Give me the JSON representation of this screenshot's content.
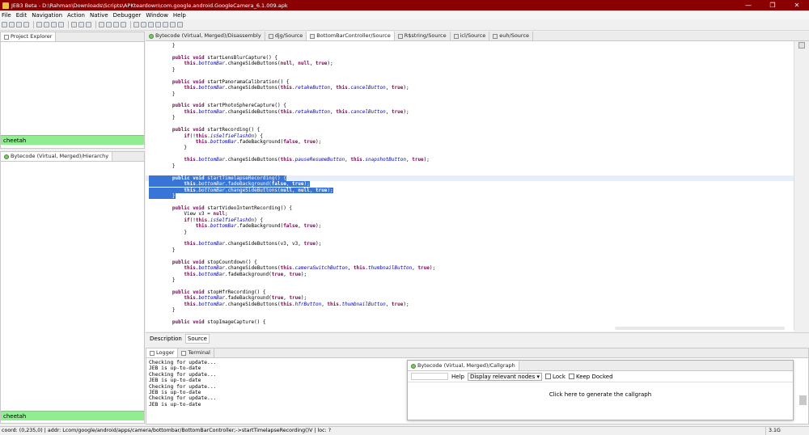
{
  "window": {
    "title": "JEB3 Beta - D:\\Rahman\\Downloads\\Scripts\\APKteardown\\com.google.android.GoogleCamera_6.1.009.apk",
    "min": "—",
    "max": "❐",
    "close": "✕"
  },
  "menu": [
    "File",
    "Edit",
    "Navigation",
    "Action",
    "Native",
    "Debugger",
    "Window",
    "Help"
  ],
  "project_explorer": {
    "tab": "Project Explorer",
    "selected": "cheetah"
  },
  "hierarchy": {
    "tab": "Bytecode (Virtual, Merged)/Hierarchy",
    "selected": "cheetah"
  },
  "editor_tabs": [
    "Bytecode (Virtual, Merged)/Disassembly",
    "djg/Source",
    "BottomBarController/Source",
    "R$string/Source",
    "icl/Source",
    "euh/Source"
  ],
  "bottom_tabs": [
    "Description",
    "Source"
  ],
  "code": [
    [
      [
        "        }",
        ""
      ]
    ],
    [
      [
        "",
        ""
      ]
    ],
    [
      [
        "        ",
        ""
      ],
      [
        "public void",
        "kw"
      ],
      [
        " startLensBlurCapture() {",
        ""
      ]
    ],
    [
      [
        "            ",
        ""
      ],
      [
        "this",
        "kw"
      ],
      [
        ".",
        ""
      ],
      [
        "bottomBar",
        "fld"
      ],
      [
        ".changeSideButtons(",
        ""
      ],
      [
        "null",
        "kw"
      ],
      [
        ", ",
        ""
      ],
      [
        "null",
        "kw"
      ],
      [
        ", ",
        ""
      ],
      [
        "true",
        "kw"
      ],
      [
        ");",
        ""
      ]
    ],
    [
      [
        "        }",
        ""
      ]
    ],
    [
      [
        "",
        ""
      ]
    ],
    [
      [
        "        ",
        ""
      ],
      [
        "public void",
        "kw"
      ],
      [
        " startPanoramaCalibration() {",
        ""
      ]
    ],
    [
      [
        "            ",
        ""
      ],
      [
        "this",
        "kw"
      ],
      [
        ".",
        ""
      ],
      [
        "bottomBar",
        "fld"
      ],
      [
        ".changeSideButtons(",
        ""
      ],
      [
        "this",
        "kw"
      ],
      [
        ".",
        ""
      ],
      [
        "retakeButton",
        "fld"
      ],
      [
        ", ",
        ""
      ],
      [
        "this",
        "kw"
      ],
      [
        ".",
        ""
      ],
      [
        "cancelButton",
        "fld"
      ],
      [
        ", ",
        ""
      ],
      [
        "true",
        "kw"
      ],
      [
        ");",
        ""
      ]
    ],
    [
      [
        "        }",
        ""
      ]
    ],
    [
      [
        "",
        ""
      ]
    ],
    [
      [
        "        ",
        ""
      ],
      [
        "public void",
        "kw"
      ],
      [
        " startPhotoSphereCapture() {",
        ""
      ]
    ],
    [
      [
        "            ",
        ""
      ],
      [
        "this",
        "kw"
      ],
      [
        ".",
        ""
      ],
      [
        "bottomBar",
        "fld"
      ],
      [
        ".changeSideButtons(",
        ""
      ],
      [
        "this",
        "kw"
      ],
      [
        ".",
        ""
      ],
      [
        "retakeButton",
        "fld"
      ],
      [
        ", ",
        ""
      ],
      [
        "this",
        "kw"
      ],
      [
        ".",
        ""
      ],
      [
        "cancelButton",
        "fld"
      ],
      [
        ", ",
        ""
      ],
      [
        "true",
        "kw"
      ],
      [
        ");",
        ""
      ]
    ],
    [
      [
        "        }",
        ""
      ]
    ],
    [
      [
        "",
        ""
      ]
    ],
    [
      [
        "        ",
        ""
      ],
      [
        "public void",
        "kw"
      ],
      [
        " startRecording() {",
        ""
      ]
    ],
    [
      [
        "            ",
        ""
      ],
      [
        "if",
        "kw"
      ],
      [
        "(!",
        ""
      ],
      [
        "this",
        "kw"
      ],
      [
        ".",
        ""
      ],
      [
        "isSelfieFlashOn",
        "fld"
      ],
      [
        ") {",
        ""
      ]
    ],
    [
      [
        "                ",
        ""
      ],
      [
        "this",
        "kw"
      ],
      [
        ".",
        ""
      ],
      [
        "bottomBar",
        "fld"
      ],
      [
        ".fadeBackground(",
        ""
      ],
      [
        "false",
        "kw"
      ],
      [
        ", ",
        ""
      ],
      [
        "true",
        "kw"
      ],
      [
        ");",
        ""
      ]
    ],
    [
      [
        "            }",
        ""
      ]
    ],
    [
      [
        "",
        ""
      ]
    ],
    [
      [
        "            ",
        ""
      ],
      [
        "this",
        "kw"
      ],
      [
        ".",
        ""
      ],
      [
        "bottomBar",
        "fld"
      ],
      [
        ".changeSideButtons(",
        ""
      ],
      [
        "this",
        "kw"
      ],
      [
        ".",
        ""
      ],
      [
        "pauseResumeButton",
        "fld"
      ],
      [
        ", ",
        ""
      ],
      [
        "this",
        "kw"
      ],
      [
        ".",
        ""
      ],
      [
        "snapshotButton",
        "fld"
      ],
      [
        ", ",
        ""
      ],
      [
        "true",
        "kw"
      ],
      [
        ");",
        ""
      ]
    ],
    [
      [
        "        }",
        ""
      ]
    ],
    [
      [
        "",
        ""
      ]
    ],
    [
      [
        "        ",
        ""
      ],
      [
        "public void",
        "kw"
      ],
      [
        " startTimelapseRecording() {",
        ""
      ]
    ],
    [
      [
        "            ",
        ""
      ],
      [
        "this",
        "kw"
      ],
      [
        ".",
        ""
      ],
      [
        "bottomBar",
        "fld"
      ],
      [
        ".fadeBackground(",
        ""
      ],
      [
        "false",
        "kw"
      ],
      [
        ", ",
        ""
      ],
      [
        "true",
        "kw"
      ],
      [
        ");",
        ""
      ]
    ],
    [
      [
        "            ",
        ""
      ],
      [
        "this",
        "kw"
      ],
      [
        ".",
        ""
      ],
      [
        "bottomBar",
        "fld"
      ],
      [
        ".changeSideButtons(",
        ""
      ],
      [
        "null",
        "kw"
      ],
      [
        ", ",
        ""
      ],
      [
        "null",
        "kw"
      ],
      [
        ", ",
        ""
      ],
      [
        "true",
        "kw"
      ],
      [
        ");",
        ""
      ]
    ],
    [
      [
        "        }",
        ""
      ]
    ],
    [
      [
        "",
        ""
      ]
    ],
    [
      [
        "        ",
        ""
      ],
      [
        "public void",
        "kw"
      ],
      [
        " startVideoIntentRecording() {",
        ""
      ]
    ],
    [
      [
        "            View v3 = ",
        ""
      ],
      [
        "null",
        "kw"
      ],
      [
        ";",
        ""
      ]
    ],
    [
      [
        "            ",
        ""
      ],
      [
        "if",
        "kw"
      ],
      [
        "(!",
        ""
      ],
      [
        "this",
        "kw"
      ],
      [
        ".",
        ""
      ],
      [
        "isSelfieFlashOn",
        "fld"
      ],
      [
        ") {",
        ""
      ]
    ],
    [
      [
        "                ",
        ""
      ],
      [
        "this",
        "kw"
      ],
      [
        ".",
        ""
      ],
      [
        "bottomBar",
        "fld"
      ],
      [
        ".fadeBackground(",
        ""
      ],
      [
        "false",
        "kw"
      ],
      [
        ", ",
        ""
      ],
      [
        "true",
        "kw"
      ],
      [
        ");",
        ""
      ]
    ],
    [
      [
        "            }",
        ""
      ]
    ],
    [
      [
        "",
        ""
      ]
    ],
    [
      [
        "            ",
        ""
      ],
      [
        "this",
        "kw"
      ],
      [
        ".",
        ""
      ],
      [
        "bottomBar",
        "fld"
      ],
      [
        ".changeSideButtons(v3, v3, ",
        ""
      ],
      [
        "true",
        "kw"
      ],
      [
        ");",
        ""
      ]
    ],
    [
      [
        "        }",
        ""
      ]
    ],
    [
      [
        "",
        ""
      ]
    ],
    [
      [
        "        ",
        ""
      ],
      [
        "public void",
        "kw"
      ],
      [
        " stopCountdown() {",
        ""
      ]
    ],
    [
      [
        "            ",
        ""
      ],
      [
        "this",
        "kw"
      ],
      [
        ".",
        ""
      ],
      [
        "bottomBar",
        "fld"
      ],
      [
        ".changeSideButtons(",
        ""
      ],
      [
        "this",
        "kw"
      ],
      [
        ".",
        ""
      ],
      [
        "cameraSwitchButton",
        "fld"
      ],
      [
        ", ",
        ""
      ],
      [
        "this",
        "kw"
      ],
      [
        ".",
        ""
      ],
      [
        "thumbnailButton",
        "fld"
      ],
      [
        ", ",
        ""
      ],
      [
        "true",
        "kw"
      ],
      [
        ");",
        ""
      ]
    ],
    [
      [
        "            ",
        ""
      ],
      [
        "this",
        "kw"
      ],
      [
        ".",
        ""
      ],
      [
        "bottomBar",
        "fld"
      ],
      [
        ".fadeBackground(",
        ""
      ],
      [
        "true",
        "kw"
      ],
      [
        ", ",
        ""
      ],
      [
        "true",
        "kw"
      ],
      [
        ");",
        ""
      ]
    ],
    [
      [
        "        }",
        ""
      ]
    ],
    [
      [
        "",
        ""
      ]
    ],
    [
      [
        "        ",
        ""
      ],
      [
        "public void",
        "kw"
      ],
      [
        " stopHfrRecording() {",
        ""
      ]
    ],
    [
      [
        "            ",
        ""
      ],
      [
        "this",
        "kw"
      ],
      [
        ".",
        ""
      ],
      [
        "bottomBar",
        "fld"
      ],
      [
        ".fadeBackground(",
        ""
      ],
      [
        "true",
        "kw"
      ],
      [
        ", ",
        ""
      ],
      [
        "true",
        "kw"
      ],
      [
        ");",
        ""
      ]
    ],
    [
      [
        "            ",
        ""
      ],
      [
        "this",
        "kw"
      ],
      [
        ".",
        ""
      ],
      [
        "bottomBar",
        "fld"
      ],
      [
        ".changeSideButtons(",
        ""
      ],
      [
        "this",
        "kw"
      ],
      [
        ".",
        ""
      ],
      [
        "hfrButton",
        "fld"
      ],
      [
        ", ",
        ""
      ],
      [
        "this",
        "kw"
      ],
      [
        ".",
        ""
      ],
      [
        "thumbnailButton",
        "fld"
      ],
      [
        ", ",
        ""
      ],
      [
        "true",
        "kw"
      ],
      [
        ");",
        ""
      ]
    ],
    [
      [
        "        }",
        ""
      ]
    ],
    [
      [
        "",
        ""
      ]
    ],
    [
      [
        "        ",
        ""
      ],
      [
        "public void",
        "kw"
      ],
      [
        " stopImageCapture() {",
        ""
      ]
    ]
  ],
  "selection": {
    "first": 22,
    "last": 25,
    "cursor_line": 22
  },
  "console": {
    "tabs": [
      "Logger",
      "Terminal"
    ],
    "lines": [
      "Checking for update...",
      "JEB is up-to-date",
      "Checking for update...",
      "JEB is up-to-date",
      "Checking for update...",
      "JEB is up-to-date",
      "Checking for update...",
      "JEB is up-to-date"
    ]
  },
  "callgraph": {
    "title": "Bytecode (Virtual, Merged)/Callgraph",
    "help": "Help",
    "select": "Display relevant nodes",
    "lock": "Lock",
    "keep_docked": "Keep Docked",
    "message": "Click here to generate the callgraph"
  },
  "status": {
    "text": "coord: (0,235,0) | addr: Lcom/google/android/apps/camera/bottombar/BottomBarController;->startTimelapseRecording()V | loc: ?",
    "memory": "3.1G"
  }
}
